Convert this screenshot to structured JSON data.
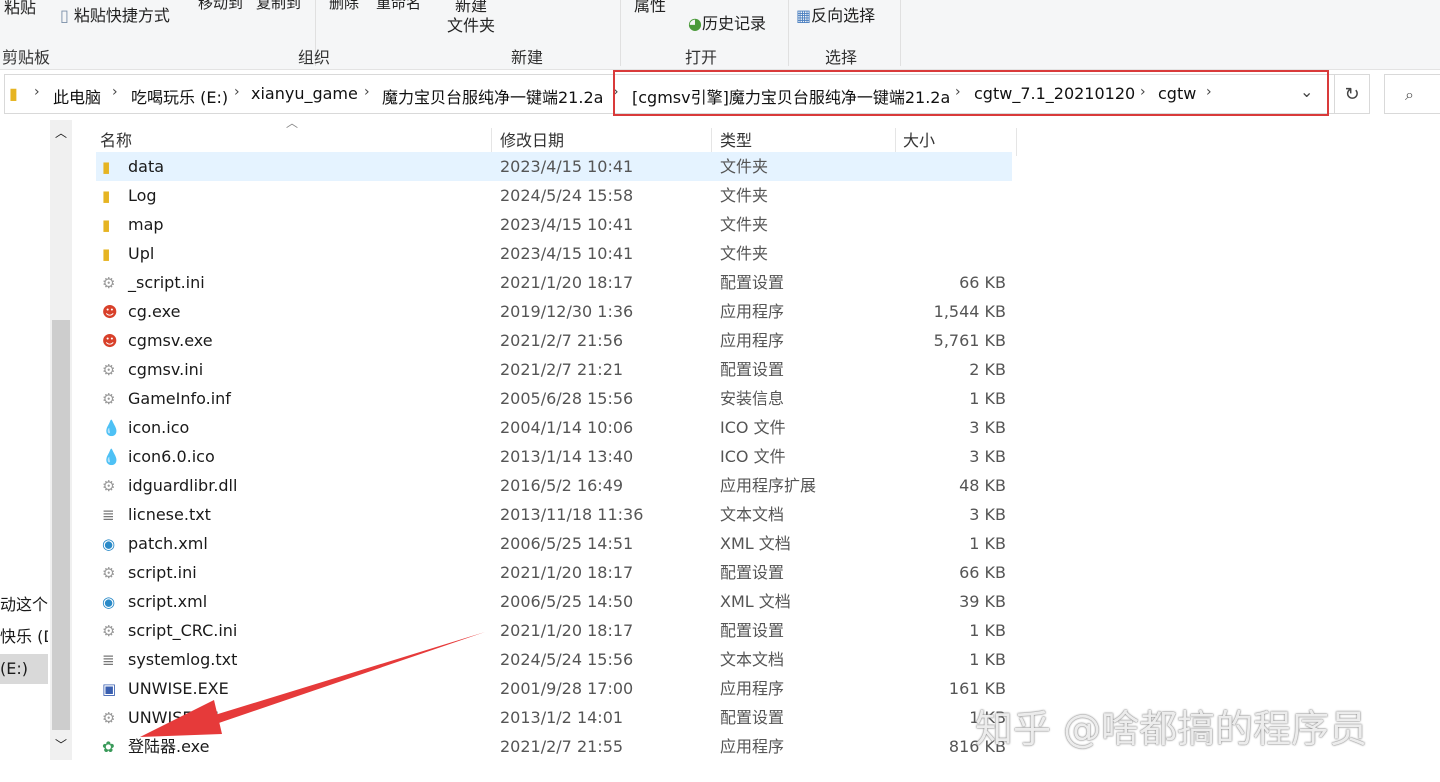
{
  "ribbon": {
    "buttons": [
      "粘贴",
      "粘贴快捷方式",
      "移动到",
      "复制到",
      "删除",
      "重命名",
      "新建",
      "文件夹",
      "属性",
      "历史记录",
      "反向选择"
    ],
    "groups": [
      "剪贴板",
      "组织",
      "新建",
      "打开",
      "选择"
    ]
  },
  "address": {
    "crumbs": [
      "此电脑",
      "吃喝玩乐 (E:)",
      "xianyu_game",
      "魔力宝贝台服纯净一键端21.2a",
      "[cgmsv引擎]魔力宝贝台服纯净一键端21.2a",
      "cgtw_7.1_20210120",
      "cgtw"
    ],
    "highlight_color": "#d93a3a"
  },
  "nav": {
    "items": [
      "动这个",
      "快乐 (D",
      "(E:)"
    ]
  },
  "columns": [
    "名称",
    "修改日期",
    "类型",
    "大小"
  ],
  "files": [
    {
      "name": "data",
      "date": "2023/4/15 10:41",
      "type": "文件夹",
      "size": "",
      "icon": "folder"
    },
    {
      "name": "Log",
      "date": "2024/5/24 15:58",
      "type": "文件夹",
      "size": "",
      "icon": "folder"
    },
    {
      "name": "map",
      "date": "2023/4/15 10:41",
      "type": "文件夹",
      "size": "",
      "icon": "folder"
    },
    {
      "name": "Upl",
      "date": "2023/4/15 10:41",
      "type": "文件夹",
      "size": "",
      "icon": "folder"
    },
    {
      "name": "_script.ini",
      "date": "2021/1/20 18:17",
      "type": "配置设置",
      "size": "66 KB",
      "icon": "ini"
    },
    {
      "name": "cg.exe",
      "date": "2019/12/30 1:36",
      "type": "应用程序",
      "size": "1,544 KB",
      "icon": "game"
    },
    {
      "name": "cgmsv.exe",
      "date": "2021/2/7 21:56",
      "type": "应用程序",
      "size": "5,761 KB",
      "icon": "game"
    },
    {
      "name": "cgmsv.ini",
      "date": "2021/2/7 21:21",
      "type": "配置设置",
      "size": "2 KB",
      "icon": "ini"
    },
    {
      "name": "GameInfo.inf",
      "date": "2005/6/28 15:56",
      "type": "安装信息",
      "size": "1 KB",
      "icon": "ini"
    },
    {
      "name": "icon.ico",
      "date": "2004/1/14 10:06",
      "type": "ICO 文件",
      "size": "3 KB",
      "icon": "ico"
    },
    {
      "name": "icon6.0.ico",
      "date": "2013/1/14 13:40",
      "type": "ICO 文件",
      "size": "3 KB",
      "icon": "ico"
    },
    {
      "name": "idguardlibr.dll",
      "date": "2016/5/2 16:49",
      "type": "应用程序扩展",
      "size": "48 KB",
      "icon": "ini"
    },
    {
      "name": "licnese.txt",
      "date": "2013/11/18 11:36",
      "type": "文本文档",
      "size": "3 KB",
      "icon": "txt"
    },
    {
      "name": "patch.xml",
      "date": "2006/5/25 14:51",
      "type": "XML 文档",
      "size": "1 KB",
      "icon": "xml"
    },
    {
      "name": "script.ini",
      "date": "2021/1/20 18:17",
      "type": "配置设置",
      "size": "66 KB",
      "icon": "ini"
    },
    {
      "name": "script.xml",
      "date": "2006/5/25 14:50",
      "type": "XML 文档",
      "size": "39 KB",
      "icon": "xml"
    },
    {
      "name": "script_CRC.ini",
      "date": "2021/1/20 18:17",
      "type": "配置设置",
      "size": "1 KB",
      "icon": "ini"
    },
    {
      "name": "systemlog.txt",
      "date": "2024/5/24 15:56",
      "type": "文本文档",
      "size": "1 KB",
      "icon": "txt"
    },
    {
      "name": "UNWISE.EXE",
      "date": "2001/9/28 17:00",
      "type": "应用程序",
      "size": "161 KB",
      "icon": "setup"
    },
    {
      "name": "UNWISE.INI",
      "date": "2013/1/2 14:01",
      "type": "配置设置",
      "size": "1 KB",
      "icon": "ini"
    },
    {
      "name": "登陆器.exe",
      "date": "2021/2/7 21:55",
      "type": "应用程序",
      "size": "816 KB",
      "icon": "launcher"
    }
  ],
  "watermark": "知乎 @啥都搞的程序员",
  "arrow_color": "#e63a3a"
}
